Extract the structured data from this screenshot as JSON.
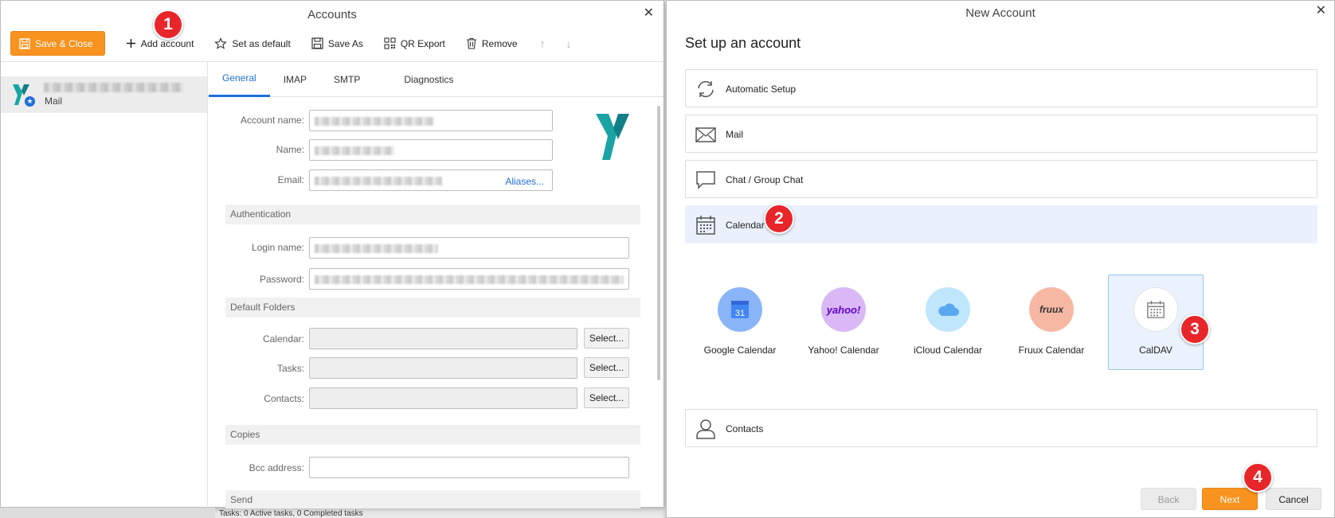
{
  "accounts_dialog": {
    "title": "Accounts",
    "toolbar": {
      "save_close": "Save & Close",
      "add_account": "Add account",
      "set_default": "Set as default",
      "save_as": "Save As",
      "qr_export": "QR Export",
      "remove": "Remove"
    },
    "account_list": [
      {
        "type": "Mail"
      }
    ],
    "tabs": [
      "General",
      "IMAP",
      "SMTP",
      "Diagnostics"
    ],
    "active_tab": "General",
    "form": {
      "account_name_label": "Account name:",
      "name_label": "Name:",
      "email_label": "Email:",
      "aliases_link": "Aliases...",
      "authentication_section": "Authentication",
      "login_name_label": "Login name:",
      "password_label": "Password:",
      "default_folders_section": "Default Folders",
      "calendar_label": "Calendar:",
      "tasks_label": "Tasks:",
      "contacts_label": "Contacts:",
      "select_label": "Select...",
      "copies_section": "Copies",
      "bcc_label": "Bcc address:",
      "send_section": "Send"
    },
    "status_text": "Tasks: 0 Active tasks, 0 Completed tasks"
  },
  "new_account_dialog": {
    "title": "New Account",
    "heading": "Set up an account",
    "options": {
      "automatic": "Automatic Setup",
      "mail": "Mail",
      "chat": "Chat / Group Chat",
      "calendar": "Calendar",
      "contacts": "Contacts"
    },
    "selected_option": "Calendar",
    "providers": [
      {
        "label": "Google Calendar",
        "icon_text": "31",
        "color": "#8ab4f8"
      },
      {
        "label": "Yahoo! Calendar",
        "icon_text": "yahoo!",
        "color": "#d9b8f5"
      },
      {
        "label": "iCloud Calendar",
        "icon_text": "",
        "color": "#bfe6fb"
      },
      {
        "label": "Fruux Calendar",
        "icon_text": "fruux",
        "color": "#f7b8a3"
      },
      {
        "label": "CalDAV",
        "icon_text": "",
        "color": "#ffffff"
      }
    ],
    "selected_provider": "CalDAV",
    "buttons": {
      "back": "Back",
      "next": "Next",
      "cancel": "Cancel"
    }
  },
  "badges": {
    "b1": "1",
    "b2": "2",
    "b3": "3",
    "b4": "4"
  },
  "colors": {
    "accent": "#f7931e",
    "link": "#1e6fd9",
    "badge": "#e8262a",
    "selection": "#eaf1fc"
  }
}
